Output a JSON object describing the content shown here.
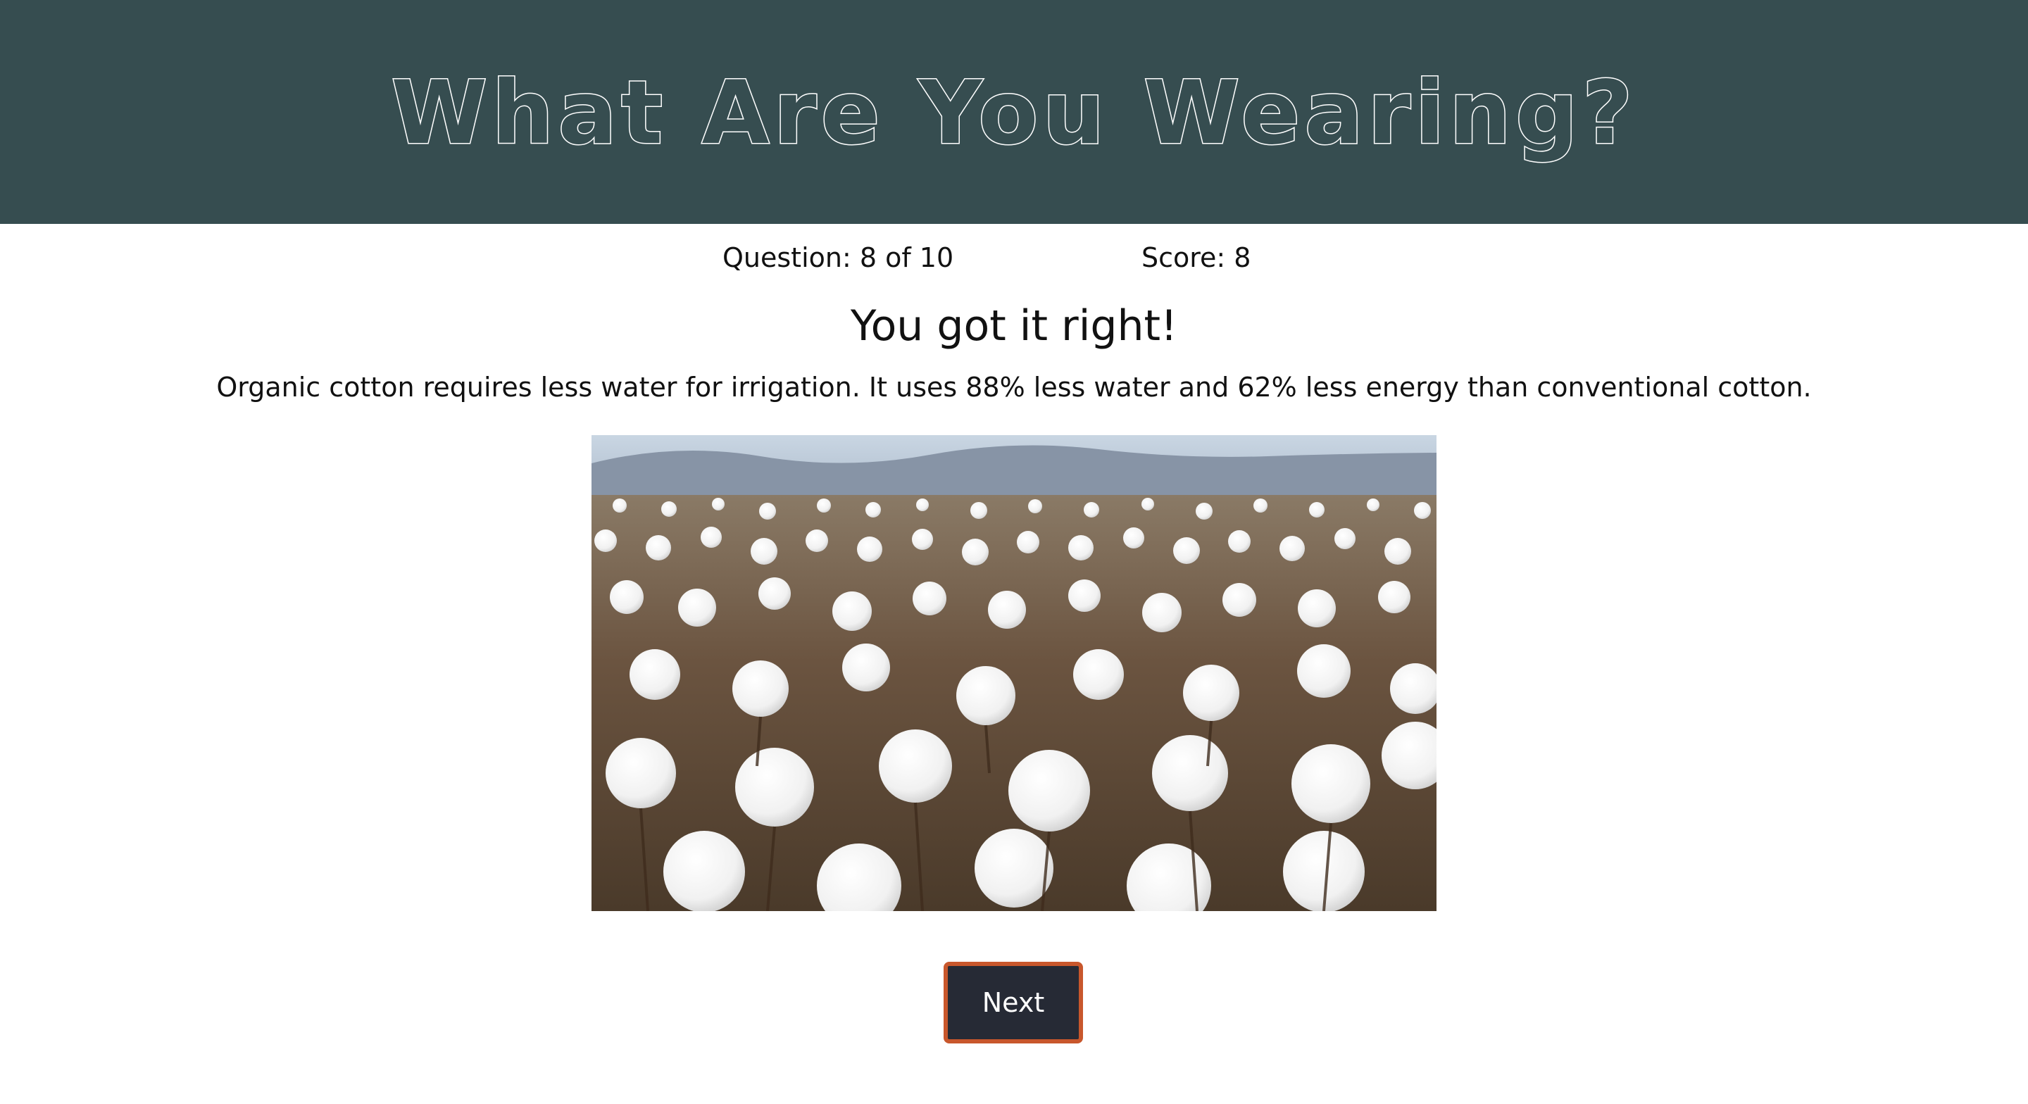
{
  "header": {
    "title": "What Are You Wearing?",
    "background_color": "#364d50"
  },
  "quiz": {
    "question_progress": "Question: 8 of 10",
    "score": "Score: 8",
    "current_question": 8,
    "total_questions": 10,
    "score_value": 8
  },
  "result": {
    "feedback": "You got it right!",
    "fact": "Organic cotton requires less water for irrigation. It uses 88% less water and 62% less energy than conventional cotton."
  },
  "image": {
    "subject": "cotton-field-photo"
  },
  "next_button": {
    "label": "Next",
    "background_color": "#262a35",
    "border_color": "#c8572c"
  }
}
